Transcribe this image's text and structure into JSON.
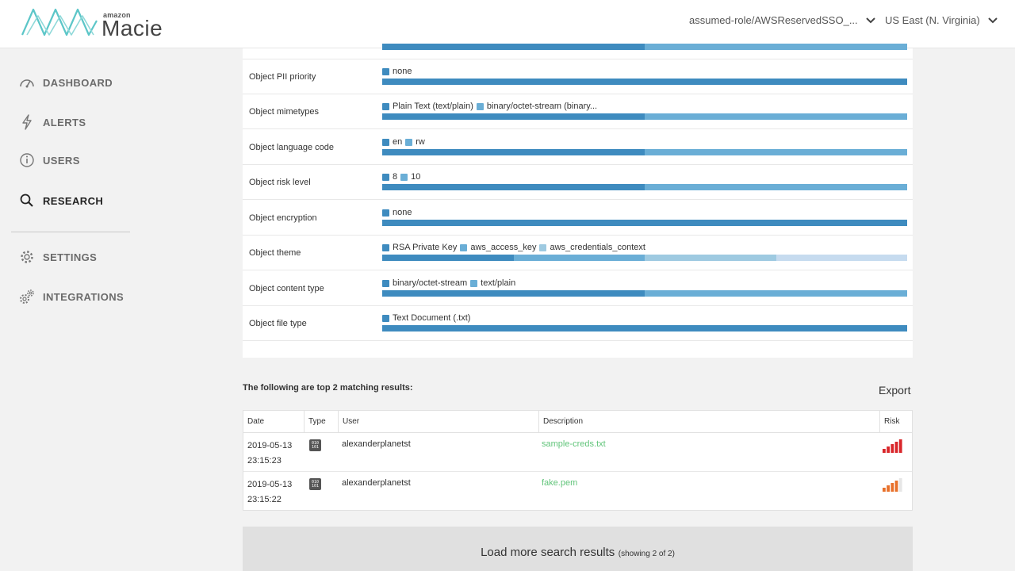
{
  "header": {
    "logo_amazon": "amazon",
    "logo_name": "Macie",
    "role_label": "assumed-role/AWSReservedSSO_...",
    "region_label": "US East (N. Virginia)"
  },
  "sidebar": {
    "items": [
      {
        "label": "DASHBOARD",
        "icon": "gauge-icon"
      },
      {
        "label": "ALERTS",
        "icon": "lightning-icon"
      },
      {
        "label": "USERS",
        "icon": "info-circle-icon"
      },
      {
        "label": "RESEARCH",
        "icon": "search-icon",
        "active": true
      },
      {
        "label": "SETTINGS",
        "icon": "gear-icon"
      },
      {
        "label": "INTEGRATIONS",
        "icon": "gears-icon"
      }
    ]
  },
  "colors": {
    "seg_dark": "#3e8bbf",
    "seg_mid": "#6aaed6",
    "seg_light": "#9ecae1",
    "seg_lightest": "#c6dbef",
    "link_green": "#61c47a"
  },
  "facets": [
    {
      "label": "",
      "items": [],
      "segments": [
        0.5,
        0.5
      ]
    },
    {
      "label": "Object PII priority",
      "items": [
        "none"
      ],
      "segments": [
        1.0
      ]
    },
    {
      "label": "Object mimetypes",
      "items": [
        "Plain Text (text/plain)",
        "binary/octet-stream (binary..."
      ],
      "segments": [
        0.5,
        0.5
      ]
    },
    {
      "label": "Object language code",
      "items": [
        "en",
        "rw"
      ],
      "segments": [
        0.5,
        0.5
      ]
    },
    {
      "label": "Object risk level",
      "items": [
        "8",
        "10"
      ],
      "segments": [
        0.5,
        0.5
      ]
    },
    {
      "label": "Object encryption",
      "items": [
        "none"
      ],
      "segments": [
        1.0
      ]
    },
    {
      "label": "Object theme",
      "items": [
        "RSA Private Key",
        "aws_access_key",
        "aws_credentials_context"
      ],
      "segments": [
        0.25,
        0.25,
        0.25,
        0.25
      ]
    },
    {
      "label": "Object content type",
      "items": [
        "binary/octet-stream",
        "text/plain"
      ],
      "segments": [
        0.5,
        0.5
      ]
    },
    {
      "label": "Object file type",
      "items": [
        "Text Document (.txt)"
      ],
      "segments": [
        1.0
      ]
    }
  ],
  "results": {
    "heading": "The following are top 2 matching results:",
    "export_label": "Export",
    "columns": [
      "Date",
      "Type",
      "User",
      "Description",
      "Risk"
    ],
    "rows": [
      {
        "date": "2019-05-13",
        "time": "23:15:23",
        "type_icon": "binary-file-icon",
        "type_glyph": "010 101",
        "user": "alexanderplanetst",
        "description": "sample-creds.txt",
        "risk_level": 5,
        "risk_color": "#d9262a"
      },
      {
        "date": "2019-05-13",
        "time": "23:15:22",
        "type_icon": "binary-file-icon",
        "type_glyph": "010 101",
        "user": "alexanderplanetst",
        "description": "fake.pem",
        "risk_level": 4,
        "risk_color": "#e8702a"
      }
    ]
  },
  "load_more": {
    "label": "Load more search results",
    "sub": "(showing 2 of 2)"
  }
}
